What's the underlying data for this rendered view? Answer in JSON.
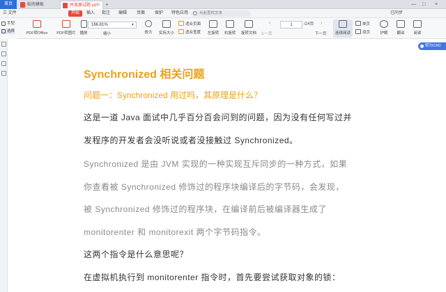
{
  "tabs": {
    "home": "首页",
    "tab1": "稻壳模板",
    "tab2": "并发面试题.pdf"
  },
  "menu": {
    "file": "三 文件",
    "items": [
      "开始",
      "插入",
      "批注",
      "编辑",
      "页面",
      "保护",
      "特色应用"
    ],
    "search_placeholder": "点此查找文本",
    "sync": "已同步"
  },
  "ribbon": {
    "hand": "手型",
    "select": "选择",
    "pdf_to_office": "PDF转Office",
    "pdf_to_image": "PDF转图片",
    "play": "播放",
    "zoom_out": "缩小",
    "zoom_value": "166.81%",
    "zoom_in": "放大",
    "actual_size": "实际大小",
    "fit_page": "适合页面",
    "fit_width": "适合宽度",
    "rotate_left": "左旋转",
    "rotate_right": "右旋转",
    "rotate_doc": "旋转文档",
    "prev_page": "上一页",
    "page_current": "1",
    "page_total": "/24页",
    "next_page": "下一页",
    "single_page": "单页",
    "dual_page": "双页",
    "continuous": "连续阅读",
    "read_mode": "阅读",
    "translate": "翻译",
    "eye_care": "护眼"
  },
  "float_button": "转为CAD",
  "document": {
    "title": "Synchronized 相关问题",
    "question": "问题一：Synchronized 用过吗，其原理是什么？",
    "p1_line1": "这是一道 Java 面试中几乎百分百会问到的问题，因为没有任何写过并",
    "p1_line2": "发程序的开发者会没听说或者没接触过 Synchronized。",
    "p2_line1": "Synchronized 是由 JVM 实现的一种实现互斥同步的一种方式，如果",
    "p2_line2": "你查看被   Synchronized   修饰过的程序块编译后的字节码，会发现，",
    "p2_line3": "被     Synchronized     修饰过的程序块，在编译前后被编译器生成了",
    "p2_line4": " monitorenter 和 monitorexit 两个字节码指令。",
    "p3": "这两个指令是什么意思呢？",
    "p4": "在虚拟机执行到 monitorenter 指令时，首先要尝试获取对象的锁："
  }
}
